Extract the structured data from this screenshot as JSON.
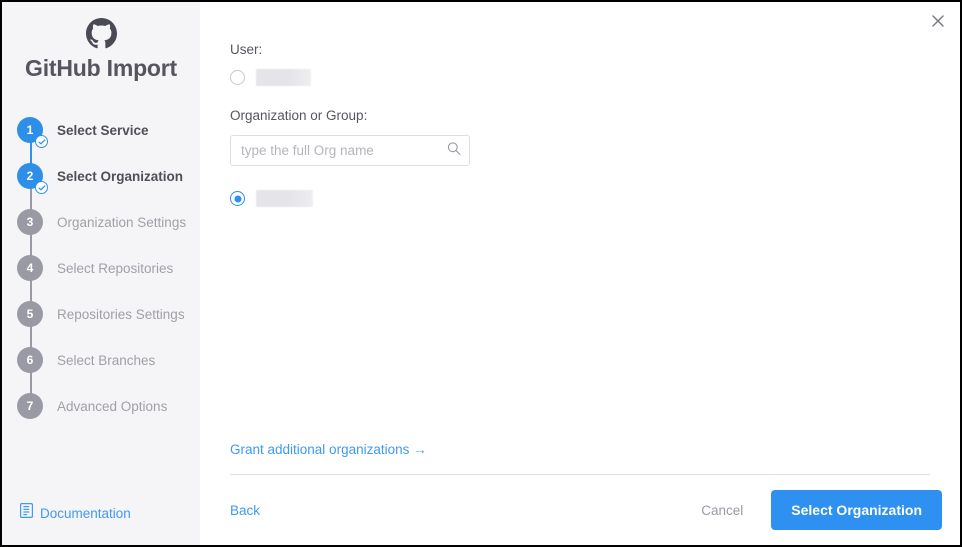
{
  "window": {
    "close_icon": "close-icon"
  },
  "sidebar": {
    "brand": {
      "logo_icon": "github-logo-icon",
      "title": "GitHub Import"
    },
    "steps": [
      {
        "number": "1",
        "label": "Select Service",
        "state": "done"
      },
      {
        "number": "2",
        "label": "Select Organization",
        "state": "done"
      },
      {
        "number": "3",
        "label": "Organization Settings",
        "state": "pending"
      },
      {
        "number": "4",
        "label": "Select Repositories",
        "state": "pending"
      },
      {
        "number": "5",
        "label": "Repositories Settings",
        "state": "pending"
      },
      {
        "number": "6",
        "label": "Select Branches",
        "state": "pending"
      },
      {
        "number": "7",
        "label": "Advanced Options",
        "state": "pending"
      }
    ],
    "documentation": {
      "icon": "document-icon",
      "label": "Documentation"
    }
  },
  "main": {
    "user_section": {
      "label": "User:",
      "option_redacted": true,
      "selected": false
    },
    "org_section": {
      "label": "Organization or Group:",
      "search": {
        "placeholder": "type the full Org name",
        "value": "",
        "icon": "search-icon"
      },
      "option_redacted": true,
      "selected": true
    },
    "grant_link": "Grant additional organizations →"
  },
  "footer": {
    "back_label": "Back",
    "cancel_label": "Cancel",
    "submit_label": "Select Organization"
  },
  "colors": {
    "accent_blue": "#2e90f0",
    "step_active": "#2e8fe8",
    "step_pending": "#9a9aa5",
    "link_blue": "#3f9af0",
    "sidebar_bg": "#f5f5f7",
    "text_dark": "#4f4f59",
    "text_muted": "#a0a0a8"
  }
}
